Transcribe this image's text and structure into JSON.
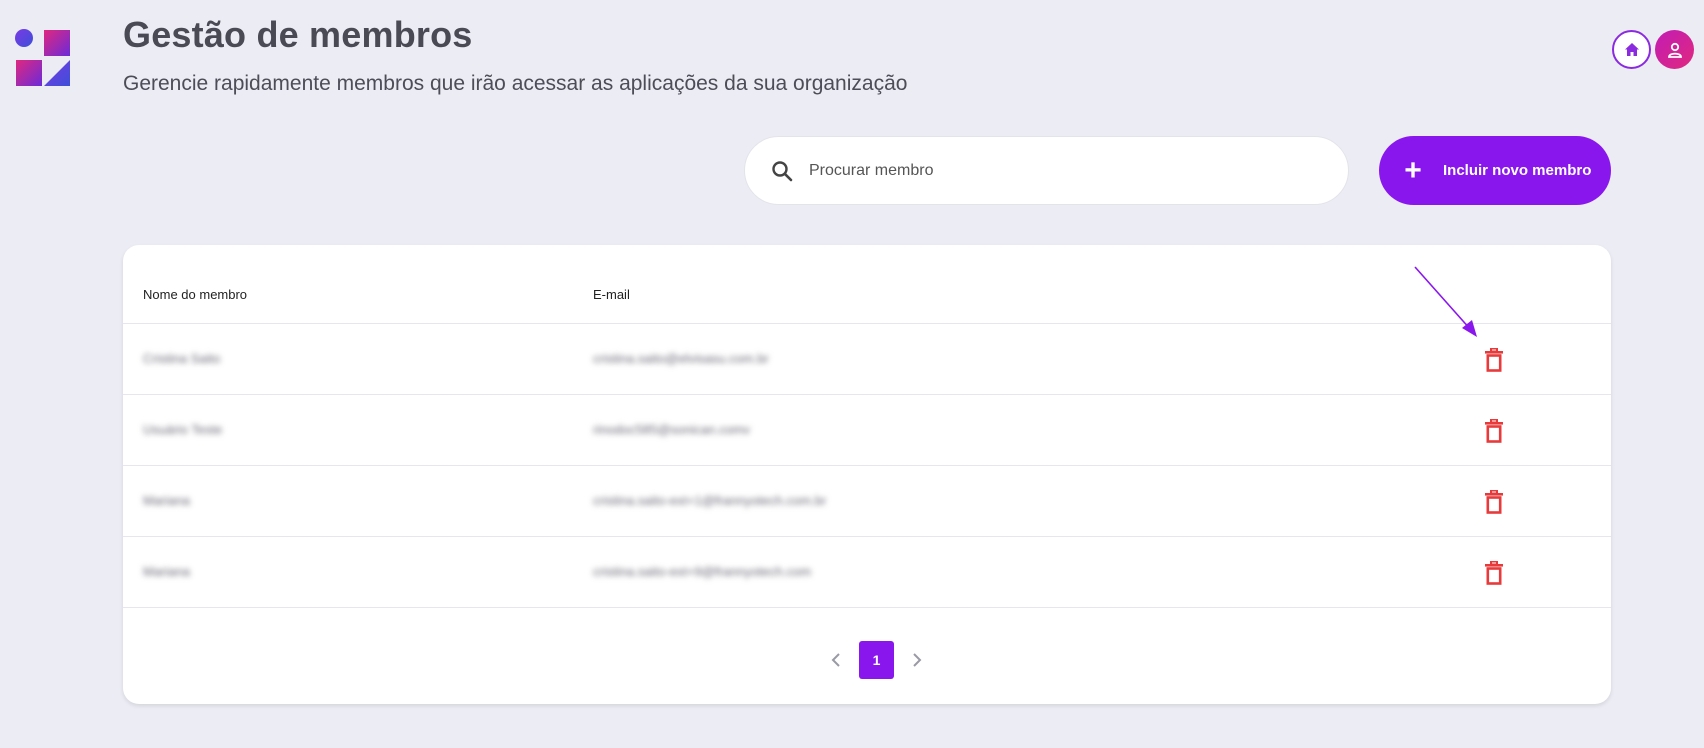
{
  "header": {
    "title": "Gestão de membros",
    "subtitle": "Gerencie rapidamente membros que irão acessar as aplicações da sua organização"
  },
  "topbar": {
    "home_icon": "home-icon",
    "user_icon": "user-icon"
  },
  "search": {
    "placeholder": "Procurar membro",
    "value": "",
    "icon": "search-icon"
  },
  "add_button": {
    "label": "Incluir novo membro",
    "icon": "plus-icon"
  },
  "table": {
    "columns": [
      "Nome do membro",
      "E-mail"
    ],
    "rows": [
      {
        "name": "Cristina Saito",
        "email": "cristina.saito@elvisasu.com.br"
      },
      {
        "name": "Usuário Teste",
        "email": "rinodoc585@sonican.comv"
      },
      {
        "name": "Mariana",
        "email": "cristina.saito-ext+1@frannyotech.com.br"
      },
      {
        "name": "Mariana",
        "email": "cristina.saito-ext+9@frannyotech.com"
      }
    ],
    "delete_icon": "trash-icon"
  },
  "pagination": {
    "current_page": "1"
  },
  "colors": {
    "accent": "#8a16ee",
    "delete": "#e83a3a",
    "background": "#ececf4",
    "avatar": "#d0219e"
  }
}
